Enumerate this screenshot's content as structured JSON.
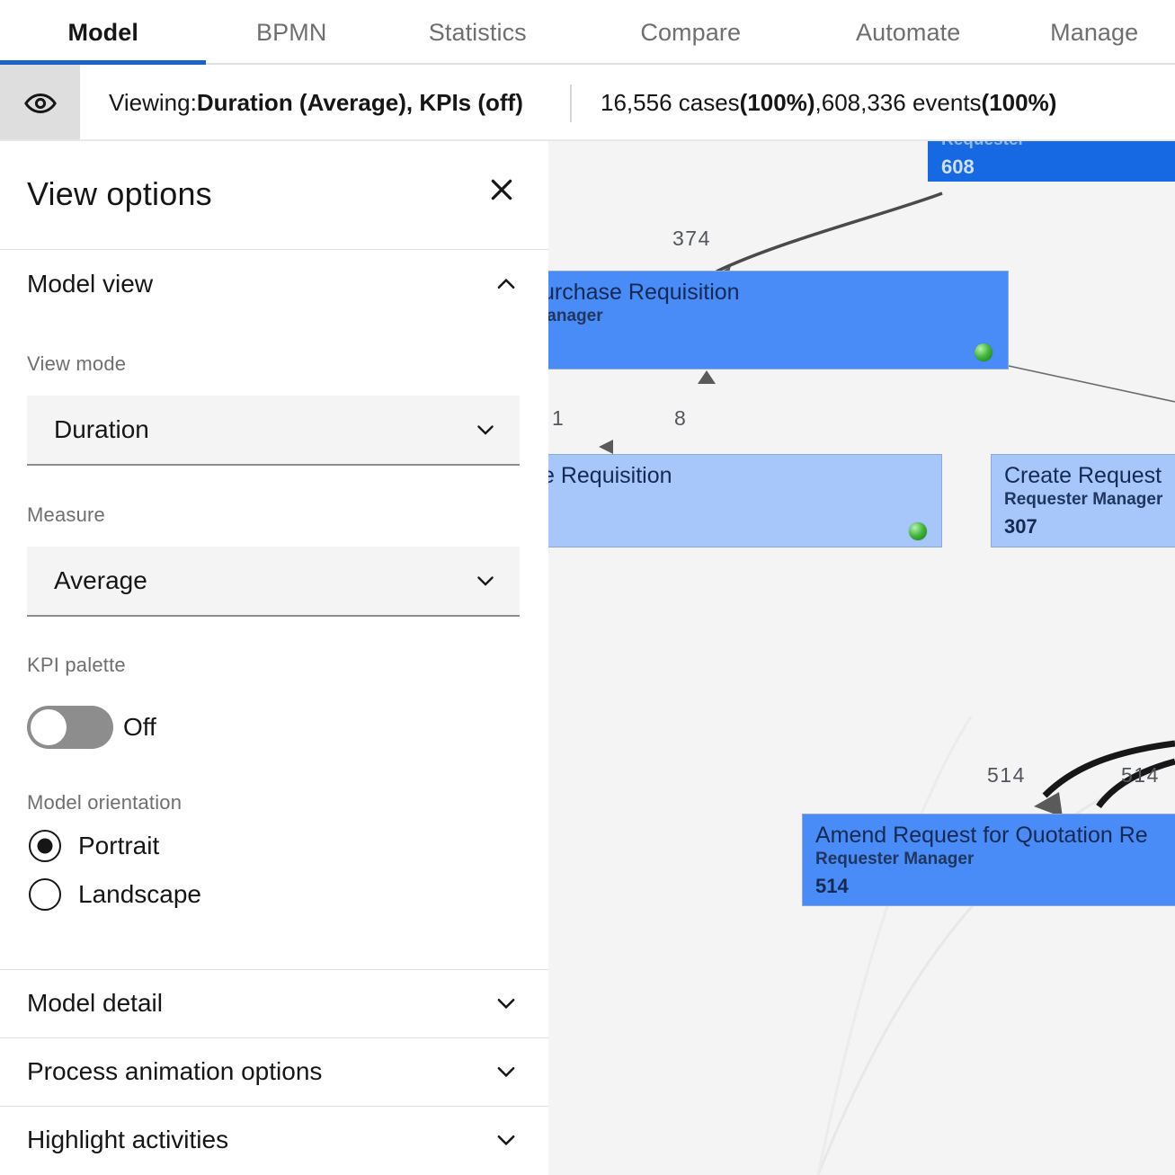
{
  "tabs": [
    {
      "label": "Model",
      "active": true
    },
    {
      "label": "BPMN",
      "active": false
    },
    {
      "label": "Statistics",
      "active": false
    },
    {
      "label": "Compare",
      "active": false
    },
    {
      "label": "Automate",
      "active": false
    },
    {
      "label": "Manage",
      "active": false
    }
  ],
  "statusbar": {
    "eye_icon": "eye-icon",
    "viewing_prefix": "Viewing: ",
    "viewing_value": "Duration (Average), KPIs (off)",
    "cases_count": "16,556 cases ",
    "cases_pct": "(100%)",
    "events_sep": ", ",
    "events_count": "608,336 events ",
    "events_pct": "(100%)"
  },
  "panel": {
    "title": "View options",
    "close_icon": "close-icon",
    "sections": {
      "model_view": {
        "label": "Model view",
        "expanded": true,
        "chevron": "chevron-up-icon",
        "view_mode": {
          "label": "View mode",
          "value": "Duration",
          "chevron": "chevron-down-icon"
        },
        "measure": {
          "label": "Measure",
          "value": "Average",
          "chevron": "chevron-down-icon"
        },
        "kpi_palette": {
          "label": "KPI palette",
          "state": "Off",
          "on": false
        },
        "model_orientation": {
          "label": "Model orientation",
          "options": [
            {
              "label": "Portrait",
              "selected": true
            },
            {
              "label": "Landscape",
              "selected": false
            }
          ]
        }
      },
      "collapsed": [
        {
          "label": "Model detail",
          "chevron": "chevron-down-icon"
        },
        {
          "label": "Process animation options",
          "chevron": "chevron-down-icon"
        },
        {
          "label": "Highlight activities",
          "chevron": "chevron-down-icon"
        }
      ]
    }
  },
  "diagram": {
    "nodes": [
      {
        "id": "n-requester-608",
        "title": "",
        "role": "Requester",
        "value": "608",
        "shade": "dark"
      },
      {
        "id": "n-purchase-requisition",
        "title": "urchase Requisition",
        "role": "lanager",
        "value": "",
        "shade": "mid"
      },
      {
        "id": "n-e-requisition",
        "title": "e Requisition",
        "role": "",
        "value": "",
        "shade": "light"
      },
      {
        "id": "n-create-request",
        "title": "Create Request",
        "role": "Requester Manager",
        "value": "307",
        "shade": "light"
      },
      {
        "id": "n-amend-rfq",
        "title": "Amend Request for Quotation Re",
        "role": "Requester Manager",
        "value": "514",
        "shade": "mid"
      }
    ],
    "edge_labels": [
      "374",
      "1",
      "8",
      "514",
      "514"
    ]
  },
  "colors": {
    "accent_blue": "#1c64c4",
    "node_dark": "#1668e3",
    "node_mid": "#4a8cf7",
    "node_light": "#a7c6fa",
    "canvas_bg": "#f4f4f4",
    "toggle_off": "#8d8d8d"
  }
}
